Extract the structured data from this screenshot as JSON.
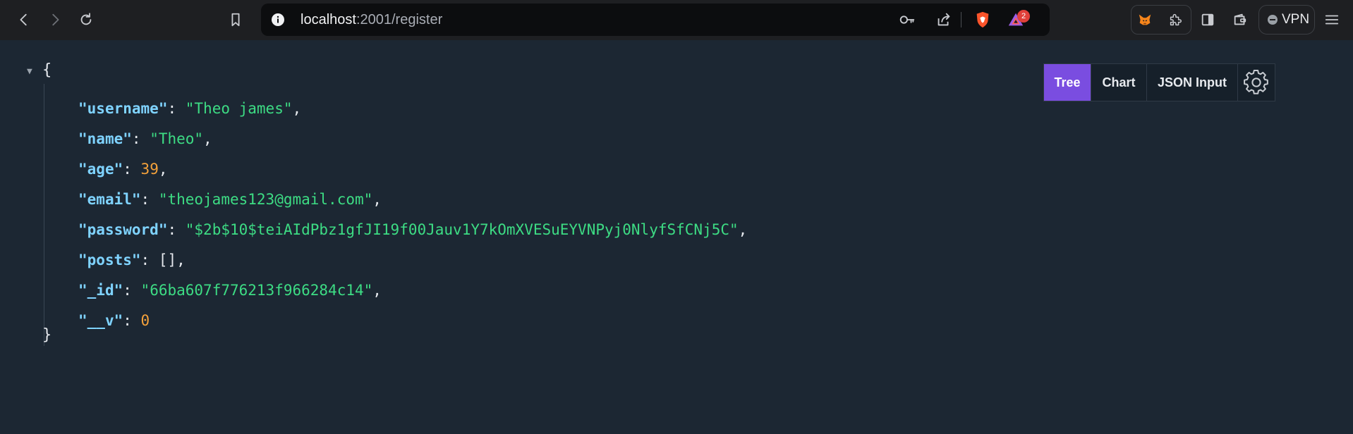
{
  "browser": {
    "url_host": "localhost",
    "url_path": ":2001/register",
    "notification_count": "2",
    "vpn_label": "VPN"
  },
  "viewer": {
    "tabs": [
      {
        "label": "Tree",
        "active": true
      },
      {
        "label": "Chart",
        "active": false
      },
      {
        "label": "JSON Input",
        "active": false
      }
    ],
    "open_brace": "{",
    "close_brace": "}",
    "fields": [
      {
        "key": "username",
        "value": "\"Theo james\"",
        "type": "string",
        "comma": ","
      },
      {
        "key": "name",
        "value": "\"Theo\"",
        "type": "string",
        "comma": ","
      },
      {
        "key": "age",
        "value": "39",
        "type": "number",
        "comma": ","
      },
      {
        "key": "email",
        "value": "\"theojames123@gmail.com\"",
        "type": "string",
        "comma": ","
      },
      {
        "key": "password",
        "value": "\"$2b$10$teiAIdPbz1gfJI19f00Jauv1Y7kOmXVESuEYVNPyj0NlyfSfCNj5C\"",
        "type": "string",
        "comma": ","
      },
      {
        "key": "posts",
        "value": "[]",
        "type": "array",
        "comma": ","
      },
      {
        "key": "_id",
        "value": "\"66ba607f776213f966284c14\"",
        "type": "string",
        "comma": ","
      },
      {
        "key": "__v",
        "value": "0",
        "type": "number",
        "comma": ""
      }
    ]
  },
  "colors": {
    "page_background": "#1c2733",
    "key": "#7fd3ff",
    "string": "#3ddc84",
    "number": "#f5a23b",
    "active_tab": "#7a4de0"
  }
}
